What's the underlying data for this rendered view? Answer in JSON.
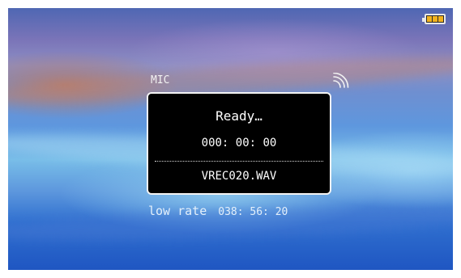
{
  "device": {
    "input_source": "MIC",
    "battery_icon": "battery-full-icon",
    "battery_color": "#f2b21f",
    "signal_icon": "signal-wave-icon"
  },
  "recorder": {
    "status": "Ready…",
    "elapsed": "000: 00: 00",
    "filename": "VREC020.WAV",
    "quality": "low rate",
    "remaining": "038: 56: 20"
  }
}
